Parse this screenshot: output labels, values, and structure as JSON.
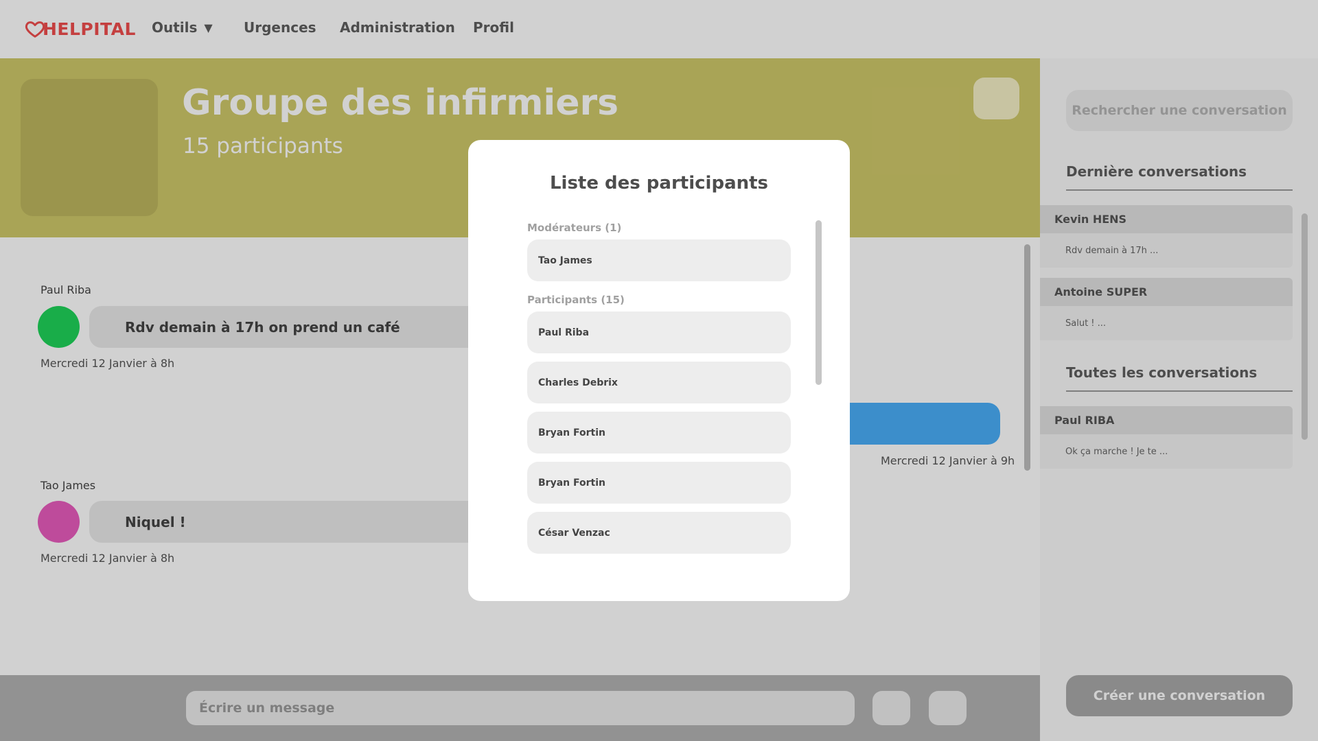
{
  "nav": {
    "logo_text": "HELPITAL",
    "items": [
      {
        "label": "Outils",
        "has_dropdown": true
      },
      {
        "label": "Urgences"
      },
      {
        "label": "Administration"
      },
      {
        "label": "Profil"
      }
    ]
  },
  "chat": {
    "title": "Groupe des infirmiers",
    "participant_count": "15 participants",
    "messages": [
      {
        "author": "Paul Riba",
        "text": "Rdv demain à 17h on prend un café",
        "time": "Mercredi 12 Janvier à 8h",
        "color": "#1fd45a"
      },
      {
        "author": "",
        "text": "",
        "time": "Mercredi 12 Janvier à 9h",
        "color": "#4aaef8"
      },
      {
        "author": "Tao James",
        "text": "Niquel !",
        "time": "Mercredi 12 Janvier à 8h",
        "color": "#e85cbd"
      }
    ],
    "compose_placeholder": "Écrire un message"
  },
  "sidebar": {
    "search_placeholder": "Rechercher une conversation",
    "recent_heading": "Dernière conversations",
    "recent": [
      {
        "name": "Kevin HENS",
        "preview": "Rdv demain à 17h ..."
      },
      {
        "name": "Antoine SUPER",
        "preview": "Salut ! ..."
      }
    ],
    "all_heading": "Toutes les conversations",
    "all": [
      {
        "name": "Paul RIBA",
        "preview": "Ok ça marche ! Je te ..."
      }
    ],
    "create_label": "Créer une conversation"
  },
  "modal": {
    "title": "Liste des participants",
    "moderators_label": "Modérateurs (1)",
    "moderators": [
      "Tao James"
    ],
    "participants_label": "Participants (15)",
    "participants": [
      "Paul Riba",
      "Charles Debrix",
      "Bryan Fortin",
      "Bryan Fortin",
      "César Venzac"
    ]
  },
  "colors": {
    "brand": "#f04d4d",
    "header_bg": "#cfc86a",
    "outgoing_bubble": "#4aaef8"
  }
}
